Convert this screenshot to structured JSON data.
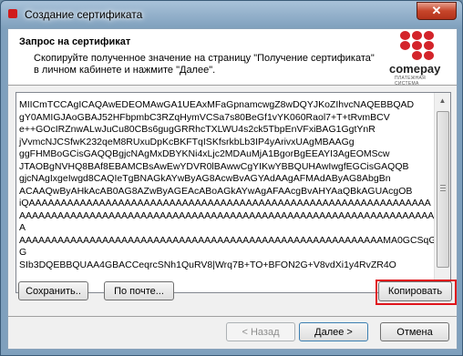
{
  "window": {
    "title": "Создание сертификата",
    "close_symbol": "✕"
  },
  "header": {
    "title": "Запрос на сертификат",
    "description": "Скопируйте полученное значение на страницу \"Получение сертификата\" в личном кабинете и нажмите \"Далее\".",
    "logo_text": "comepay",
    "logo_sub": "ПЛАТЕЖНАЯ СИСТЕМА"
  },
  "certificate_text": {
    "lines": [
      "MIICmTCCAgICAQAwEDEOMAwGA1UEAxMFaGpnamcwgZ8wDQYJKoZIhvcNAQEBBQAD",
      "gY0AMIGJAoGBAJ52HFbpmbC3RZqHymVCSa7s80BeGf1vYK060Raol7+T+tRvmBCV",
      "e++GOcIRZnwALwJuCu80CBs6gugGRRhcTXLWU4s2ck5TbpEnVFxiBAG1GgtYnR",
      "jVvmcNJCSfwK232qeM8RUxuDpKcBKFTqISKfsrkbLb3IP4yArivxUAgMBAAGg",
      "ggFHMBoGCisGAQQBgjcNAgMxDBYKNi4xLjc2MDAuMjA1BgorBgEEAYI3AgEOMScw",
      "JTAOBgNVHQ8BAf8EBAMCBsAwEwYDVR0lBAwwCgYIKwYBBQUHAwIwgfEGCisGAQQB",
      "gjcNAgIxgeIwgd8CAQIeTgBNAGkAYwByAG8AcwBvAGYAdAAgAFMAdAByAG8AbgBn",
      "ACAAQwByAHkAcAB0AG8AZwByAGEAcABoAGkAYwAgAFAAcgBvAHYAaQBkAGUAcgOB",
      "iQAAAAAAAAAAAAAAAAAAAAAAAAAAAAAAAAAAAAAAAAAAAAAAAAAAAAAAAAAAAAAAA",
      "AAAAAAAAAAAAAAAAAAAAAAAAAAAAAAAAAAAAAAAAAAAAAAAAAAAAAAAAAAAAAAAAA",
      "A",
      "AAAAAAAAAAAAAAAAAAAAAAAAAAAAAAAAAAAAAAAAAAAAAAAAAAAAAAAAAMA0GCSqG",
      "G",
      "SIb3DQEBBQUAA4GBACCeqrcSNh1QuRV8|Wrq7B+TO+BFON2G+V8vdXi1y4RvZR4O"
    ]
  },
  "buttons": {
    "save": "Сохранить..",
    "email": "По почте...",
    "copy": "Копировать",
    "back": "< Назад",
    "next": "Далее >",
    "cancel": "Отмена"
  },
  "scrollbar": {
    "up_arrow": "▲",
    "down_arrow": "▼"
  }
}
